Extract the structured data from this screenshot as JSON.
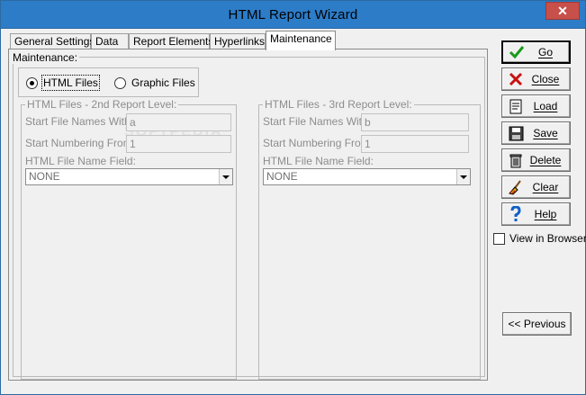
{
  "window": {
    "title": "HTML Report Wizard",
    "close_glyph": "✕"
  },
  "tabs": [
    {
      "label": "General Settings",
      "active": false
    },
    {
      "label": "Data",
      "active": false
    },
    {
      "label": "Report Elements",
      "active": false
    },
    {
      "label": "Hyperlinks",
      "active": false
    },
    {
      "label": "Maintenance",
      "active": true
    }
  ],
  "maintenance": {
    "group_label": "Maintenance:",
    "radio_html": "HTML Files",
    "radio_graphic": "Graphic Files",
    "selected": "HTML Files"
  },
  "level2": {
    "group_label": "HTML Files - 2nd Report Level:",
    "start_names_label": "Start File Names With:",
    "start_names_value": "a",
    "start_numbering_label": "Start Numbering From:",
    "start_numbering_value": "1",
    "name_field_label": "HTML File Name Field:",
    "name_field_value": "NONE"
  },
  "level3": {
    "group_label": "HTML Files - 3rd Report Level:",
    "start_names_label": "Start File Names With:",
    "start_names_value": "b",
    "start_numbering_label": "Start Numbering From:",
    "start_numbering_value": "1",
    "name_field_label": "HTML File Name Field:",
    "name_field_value": "NONE"
  },
  "buttons": {
    "go": "Go",
    "close": "Close",
    "load": "Load",
    "save": "Save",
    "delete": "Delete",
    "clear": "Clear",
    "help": "Help",
    "view_in_browser": "View in Browser",
    "previous": "<< Previous"
  },
  "view_in_browser_checked": false,
  "icons": [
    "close-icon",
    "checkmark-icon",
    "x-icon",
    "document-icon",
    "floppy-save-icon",
    "trash-icon",
    "broom-icon",
    "help-icon",
    "chevron-down-icon"
  ],
  "colors": {
    "title_bar": "#2c7cc8",
    "window_close": "#c7504b",
    "go_icon": "#1a9a1a",
    "close_icon": "#c81010",
    "help_icon": "#1060c8"
  }
}
